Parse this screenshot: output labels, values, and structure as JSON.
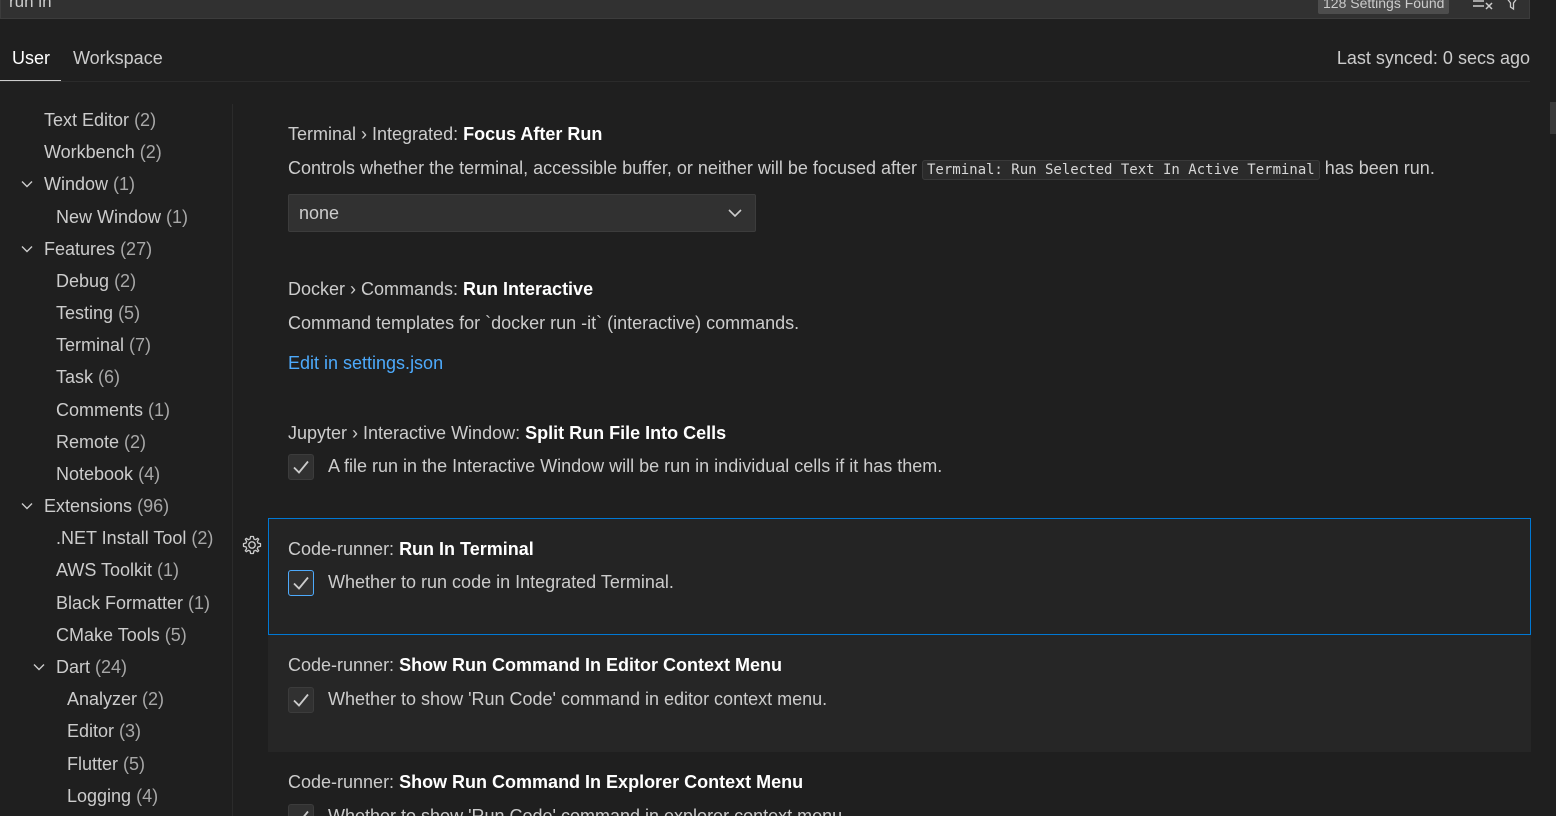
{
  "search": {
    "query": "run in",
    "results_count": "128 Settings Found"
  },
  "tabs": {
    "user": "User",
    "workspace": "Workspace"
  },
  "sync_status": "Last synced: 0 secs ago",
  "toc": [
    {
      "label": "Text Editor",
      "count": "(2)"
    },
    {
      "label": "Workbench",
      "count": "(2)"
    },
    {
      "label": "Window",
      "count": "(1)",
      "expanded": true
    },
    {
      "label": "New Window",
      "count": "(1)"
    },
    {
      "label": "Features",
      "count": "(27)",
      "expanded": true
    },
    {
      "label": "Debug",
      "count": "(2)"
    },
    {
      "label": "Testing",
      "count": "(5)"
    },
    {
      "label": "Terminal",
      "count": "(7)"
    },
    {
      "label": "Task",
      "count": "(6)"
    },
    {
      "label": "Comments",
      "count": "(1)"
    },
    {
      "label": "Remote",
      "count": "(2)"
    },
    {
      "label": "Notebook",
      "count": "(4)"
    },
    {
      "label": "Extensions",
      "count": "(96)",
      "expanded": true
    },
    {
      "label": ".NET Install Tool",
      "count": "(2)"
    },
    {
      "label": "AWS Toolkit",
      "count": "(1)"
    },
    {
      "label": "Black Formatter",
      "count": "(1)"
    },
    {
      "label": "CMake Tools",
      "count": "(5)"
    },
    {
      "label": "Dart",
      "count": "(24)",
      "expanded": true
    },
    {
      "label": "Analyzer",
      "count": "(2)"
    },
    {
      "label": "Editor",
      "count": "(3)"
    },
    {
      "label": "Flutter",
      "count": "(5)"
    },
    {
      "label": "Logging",
      "count": "(4)"
    }
  ],
  "settings": {
    "focus_after_run": {
      "category": "Terminal › Integrated: ",
      "key": "Focus After Run",
      "desc_before": "Controls whether the terminal, accessible buffer, or neither will be focused after ",
      "desc_code": "Terminal: Run Selected Text In Active Terminal",
      "desc_after": " has been run.",
      "value": "none"
    },
    "docker_run_interactive": {
      "category": "Docker › Commands: ",
      "key": "Run Interactive",
      "desc": "Command templates for `docker run -it` (interactive) commands.",
      "link": "Edit in settings.json"
    },
    "jupyter_split": {
      "category": "Jupyter › Interactive Window: ",
      "key": "Split Run File Into Cells",
      "desc": "A file run in the Interactive Window will be run in individual cells if it has them.",
      "checked": true
    },
    "run_in_terminal": {
      "category": "Code-runner: ",
      "key": "Run In Terminal",
      "desc": "Whether to run code in Integrated Terminal.",
      "checked": true
    },
    "editor_context": {
      "category": "Code-runner: ",
      "key": "Show Run Command In Editor Context Menu",
      "desc": "Whether to show 'Run Code' command in editor context menu.",
      "checked": true
    },
    "explorer_context": {
      "category": "Code-runner: ",
      "key": "Show Run Command In Explorer Context Menu",
      "desc": "Whether to show 'Run Code' command in explorer context menu.",
      "checked": true
    }
  },
  "colors": {
    "background": "#1f1f1f",
    "link": "#4daafc",
    "focus_border": "#0078d4"
  }
}
